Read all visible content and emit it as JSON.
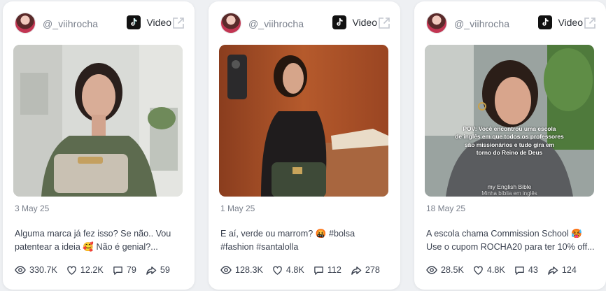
{
  "cards": [
    {
      "username": "@_viihrocha",
      "platform": "Video",
      "date": "3 May 25",
      "text_line1": "Alguma marca já fez isso? Se não.. Vou",
      "text_line2": "patentear a ideia 🥰 Não é genial?...",
      "views": "330.7K",
      "likes": "12.2K",
      "comments": "79",
      "shares": "59"
    },
    {
      "username": "@_viihrocha",
      "platform": "Video",
      "date": "1 May 25",
      "text_line1": "E aí, verde ou marrom? 🤬 #bolsa",
      "text_line2": "#fashion #santalolla",
      "views": "128.3K",
      "likes": "4.8K",
      "comments": "112",
      "shares": "278"
    },
    {
      "username": "@_viihrocha",
      "platform": "Video",
      "date": "18 May 25",
      "text_line1": "A escola chama Commission School 🥵",
      "text_line2": "Use o cupom ROCHA20 para ter 10% off...",
      "views": "28.5K",
      "likes": "4.8K",
      "comments": "43",
      "shares": "124",
      "overlay_line1": "POV: Você encontrou uma escola",
      "overlay_line2": "de inglês em que todos os professores",
      "overlay_line3": "são missionários e tudo gira em",
      "overlay_line4": "torno do Reino de Deus",
      "overlay_caption": "my English Bible",
      "overlay_caption_sub": "Minha bíblia em inglês"
    }
  ]
}
